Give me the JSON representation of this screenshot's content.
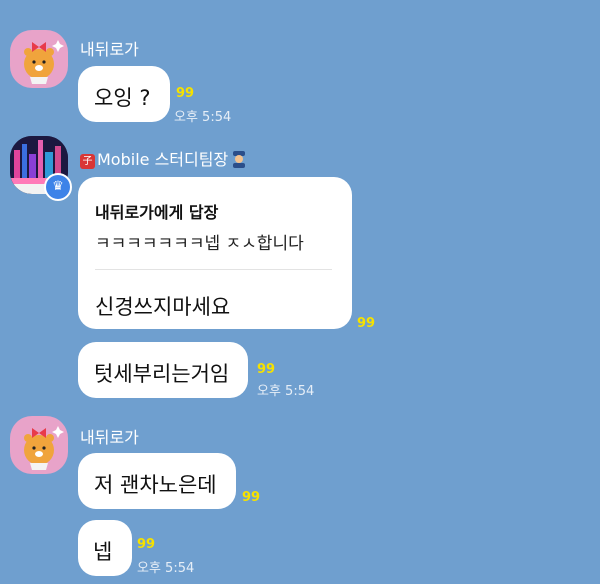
{
  "messages": [
    {
      "sender": "내뒤로가",
      "text": "오잉 ?",
      "unread": "99",
      "time": "오후 5:54"
    },
    {
      "sender": "Mobile 스터디팀장",
      "reply": {
        "title": "내뒤로가에게 답장",
        "quoted": "ㅋㅋㅋㅋㅋㅋㅋ넵 ㅈㅅ합니다",
        "text": "신경쓰지마세요"
      },
      "unread": "99"
    },
    {
      "text": "텃세부리는거임",
      "unread": "99",
      "time": "오후 5:54"
    },
    {
      "sender": "내뒤로가",
      "text": "저 괜차노은데",
      "unread": "99"
    },
    {
      "text": "넵",
      "unread": "99",
      "time": "오후 5:54"
    }
  ],
  "icons": {
    "leader_tag": "red-badge-icon",
    "police": "police-officer-icon",
    "crown": "crown-icon"
  },
  "colors": {
    "background": "#6f9fcf",
    "bubble": "#ffffff",
    "unread": "#f6e100"
  }
}
